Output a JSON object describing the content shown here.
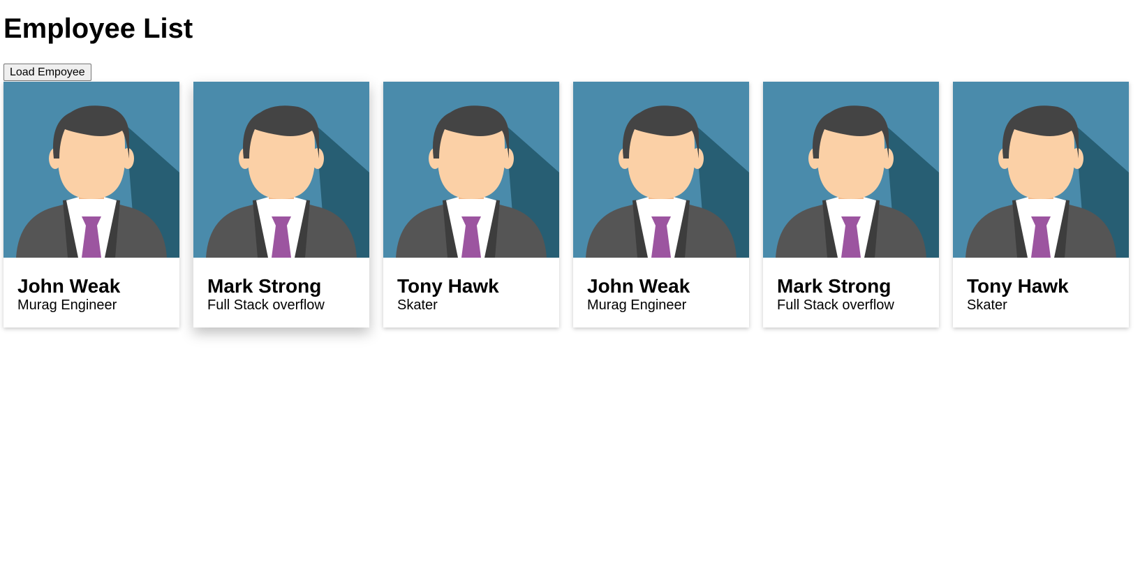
{
  "page": {
    "title": "Employee List"
  },
  "toolbar": {
    "load_label": "Load Empoyee"
  },
  "colors": {
    "avatar_bg": "#4a8bab",
    "avatar_shadow": "#275e73",
    "hair": "#444444",
    "skin": "#fbd0a6",
    "suit": "#555555",
    "suit_dark": "#3d3d3d",
    "shirt": "#ffffff",
    "tie": "#9c55a0"
  },
  "employees": [
    {
      "name": "John Weak",
      "role": "Murag Engineer",
      "avatar_icon": "businessman-avatar-icon"
    },
    {
      "name": "Mark Strong",
      "role": "Full Stack overflow",
      "avatar_icon": "businessman-avatar-icon"
    },
    {
      "name": "Tony Hawk",
      "role": "Skater",
      "avatar_icon": "businessman-avatar-icon"
    },
    {
      "name": "John Weak",
      "role": "Murag Engineer",
      "avatar_icon": "businessman-avatar-icon"
    },
    {
      "name": "Mark Strong",
      "role": "Full Stack overflow",
      "avatar_icon": "businessman-avatar-icon"
    },
    {
      "name": "Tony Hawk",
      "role": "Skater",
      "avatar_icon": "businessman-avatar-icon"
    }
  ]
}
